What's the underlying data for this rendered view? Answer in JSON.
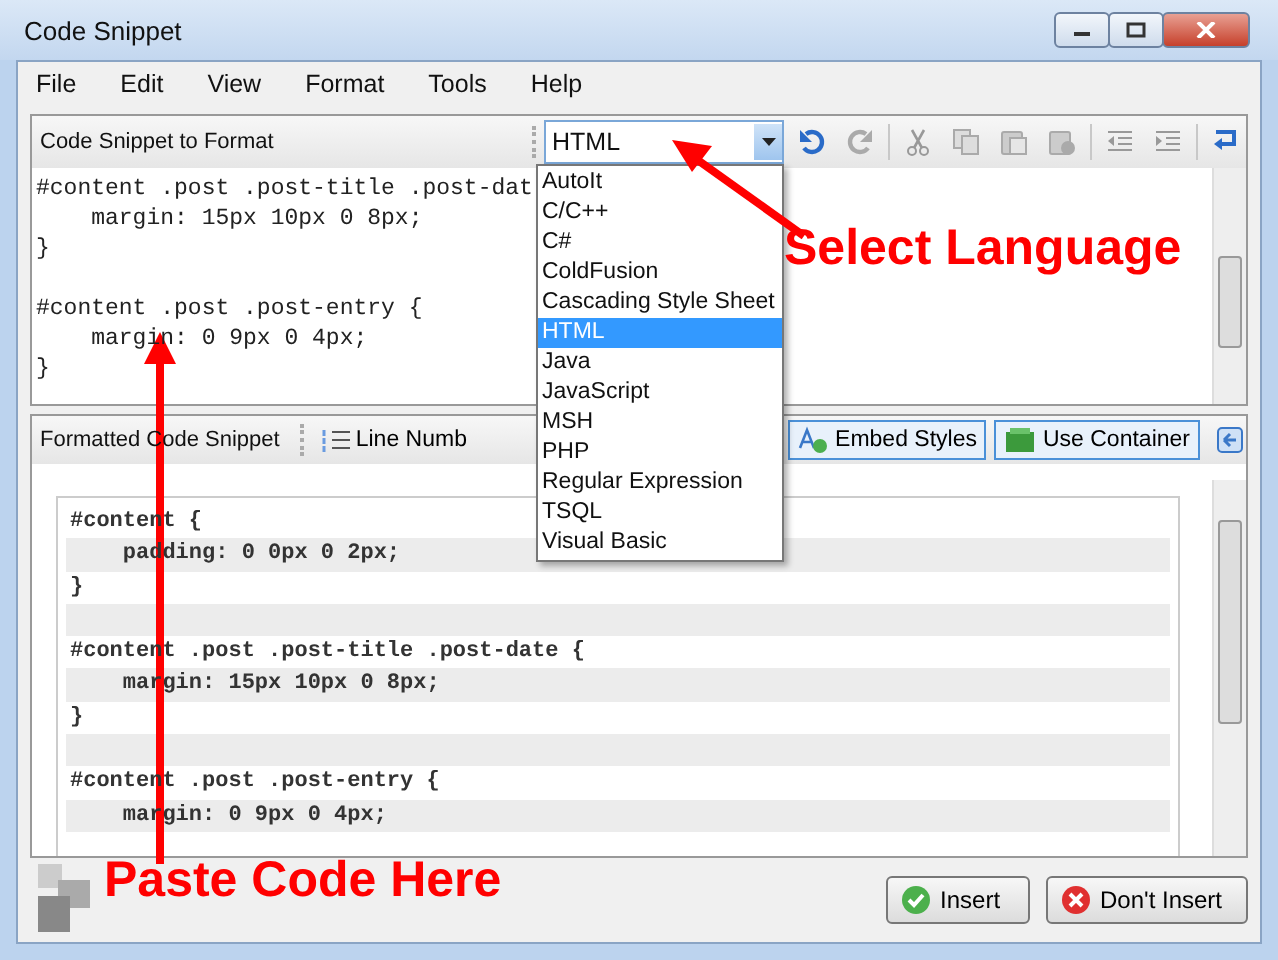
{
  "window": {
    "title": "Code Snippet"
  },
  "menu": [
    {
      "label": "File"
    },
    {
      "label": "Edit"
    },
    {
      "label": "View"
    },
    {
      "label": "Format"
    },
    {
      "label": "Tools"
    },
    {
      "label": "Help"
    }
  ],
  "top_panel": {
    "title": "Code Snippet to Format",
    "language": {
      "value": "HTML",
      "options": [
        {
          "label": "AutoIt",
          "selected": false
        },
        {
          "label": "C/C++",
          "selected": false
        },
        {
          "label": "C#",
          "selected": false
        },
        {
          "label": "ColdFusion",
          "selected": false
        },
        {
          "label": "Cascading Style Sheet",
          "selected": false
        },
        {
          "label": "HTML",
          "selected": true
        },
        {
          "label": "Java",
          "selected": false
        },
        {
          "label": "JavaScript",
          "selected": false
        },
        {
          "label": "MSH",
          "selected": false
        },
        {
          "label": "PHP",
          "selected": false
        },
        {
          "label": "Regular Expression",
          "selected": false
        },
        {
          "label": "TSQL",
          "selected": false
        },
        {
          "label": "Visual Basic",
          "selected": false
        }
      ]
    },
    "code_blocks": [
      [
        "#content .post .post-title .post-dat",
        "    margin: 15px 10px 0 8px;",
        "}"
      ],
      [
        "#content .post .post-entry {",
        "    margin: 0 9px 0 4px;",
        "}"
      ]
    ]
  },
  "bottom_panel": {
    "title": "Formatted Code Snippet",
    "toolbar": [
      {
        "label": "Line Numb",
        "on": false
      },
      {
        "label": "Embed Styles",
        "on": true
      },
      {
        "label": "Use Container",
        "on": true
      }
    ],
    "code_blocks": [
      [
        "#content {",
        "    padding: 0 0px 0 2px;",
        "}"
      ],
      [
        "#content .post .post-title .post-date {",
        "    margin: 15px 10px 0 8px;",
        "}"
      ],
      [
        "#content .post .post-entry {",
        "    margin: 0 9px 0 4px;"
      ]
    ]
  },
  "buttons": [
    {
      "label": "Insert",
      "kind": "ok"
    },
    {
      "label": "Don't Insert",
      "kind": "cancel"
    }
  ],
  "annotations": [
    {
      "text": "Select Language"
    },
    {
      "text": "Paste Code Here"
    }
  ]
}
